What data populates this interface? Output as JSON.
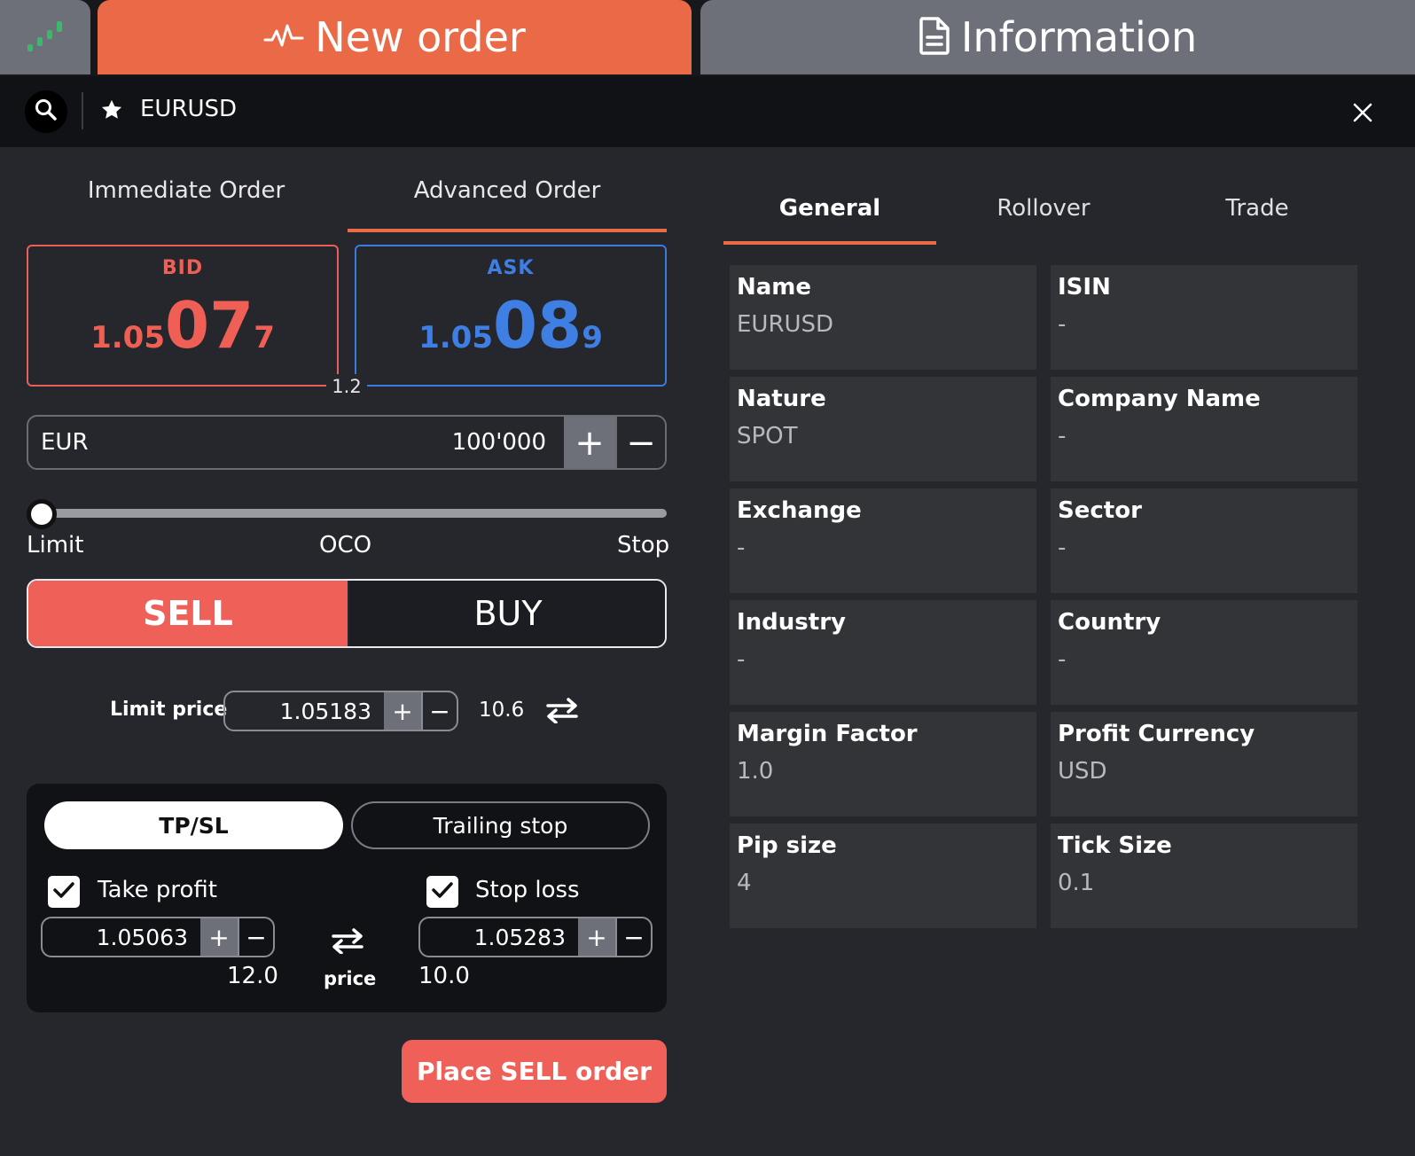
{
  "top_tabs": {
    "new_order_label": "New order",
    "information_label": "Information"
  },
  "search": {
    "symbol": "EURUSD"
  },
  "order_types": {
    "immediate": "Immediate Order",
    "advanced": "Advanced Order",
    "active": "Advanced Order"
  },
  "quote": {
    "bid_label": "BID",
    "bid_prefix": "1.05",
    "bid_big": "07",
    "bid_pip": "7",
    "ask_label": "ASK",
    "ask_prefix": "1.05",
    "ask_big": "08",
    "ask_pip": "9",
    "spread": "1.2",
    "bid_color": "#ef5f55",
    "ask_color": "#3f7fe4"
  },
  "amount": {
    "currency": "EUR",
    "value": "100'000"
  },
  "order_mode_slider": {
    "labels": [
      "Limit",
      "OCO",
      "Stop"
    ],
    "selected": "Limit"
  },
  "side": {
    "sell_label": "SELL",
    "buy_label": "BUY",
    "selected": "SELL"
  },
  "limit_price": {
    "label": "Limit price",
    "value": "1.05183",
    "distance": "10.6"
  },
  "tpsl": {
    "tab_tpsl": "TP/SL",
    "tab_trailing": "Trailing stop",
    "take_profit_label": "Take profit",
    "take_profit_value": "1.05063",
    "take_profit_distance": "12.0",
    "stop_loss_label": "Stop loss",
    "stop_loss_value": "1.05283",
    "stop_loss_distance": "10.0",
    "swap_label": "price"
  },
  "place_order_label": "Place SELL order",
  "info": {
    "tabs": [
      "General",
      "Rollover",
      "Trade"
    ],
    "active_tab": "General",
    "fields": [
      {
        "title": "Name",
        "value": "EURUSD"
      },
      {
        "title": "ISIN",
        "value": "-"
      },
      {
        "title": "Nature",
        "value": "SPOT"
      },
      {
        "title": "Company Name",
        "value": "-"
      },
      {
        "title": "Exchange",
        "value": "-"
      },
      {
        "title": "Sector",
        "value": "-"
      },
      {
        "title": "Industry",
        "value": "-"
      },
      {
        "title": "Country",
        "value": "-"
      },
      {
        "title": "Margin Factor",
        "value": "1.0"
      },
      {
        "title": "Profit Currency",
        "value": "USD"
      },
      {
        "title": "Pip size",
        "value": "4"
      },
      {
        "title": "Tick Size",
        "value": "0.1"
      }
    ]
  },
  "colors": {
    "accent": "#ea6a47",
    "sell": "#ef6058",
    "chart_icon": "#3fb56f"
  }
}
